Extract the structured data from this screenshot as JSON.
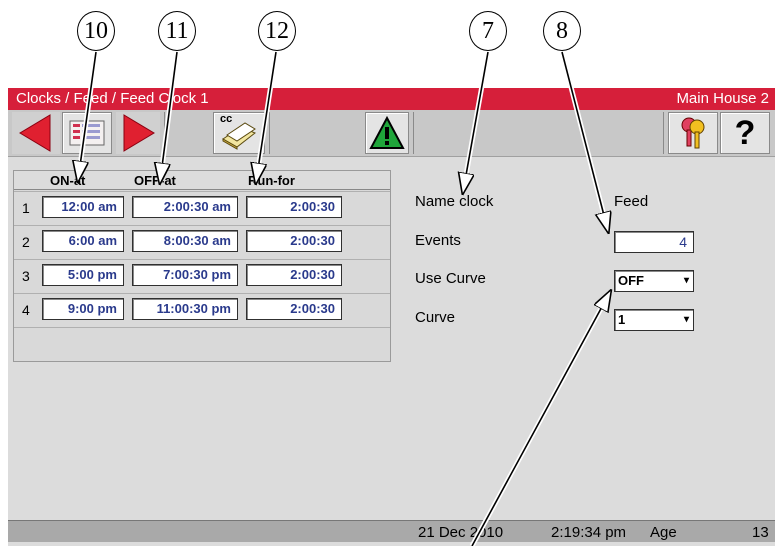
{
  "callouts": [
    "10",
    "11",
    "12",
    "7",
    "8"
  ],
  "titlebar": {
    "breadcrumb": "Clocks / Feed / Feed Clock 1",
    "house": "Main House 2"
  },
  "toolbar": {
    "back_icon": "left-arrow-icon",
    "list_icon": "list-icon",
    "forward_icon": "right-arrow-icon",
    "cc_label": "cc",
    "alarm_icon": "warning-icon",
    "keys_icon": "keys-icon",
    "help_label": "?"
  },
  "table": {
    "headers": {
      "on": "ON-at",
      "off": "OFF-at",
      "run": "Run-for"
    },
    "rows": [
      {
        "num": "1",
        "on": "12:00 am",
        "off": "2:00:30 am",
        "run": "2:00:30"
      },
      {
        "num": "2",
        "on": "6:00 am",
        "off": "8:00:30 am",
        "run": "2:00:30"
      },
      {
        "num": "3",
        "on": "5:00 pm",
        "off": "7:00:30 pm",
        "run": "2:00:30"
      },
      {
        "num": "4",
        "on": "9:00 pm",
        "off": "11:00:30 pm",
        "run": "2:00:30"
      }
    ]
  },
  "settings": {
    "name_label": "Name clock",
    "name_value": "Feed",
    "events_label": "Events",
    "events_value": "4",
    "use_curve_label": "Use Curve",
    "use_curve_value": "OFF",
    "curve_label": "Curve",
    "curve_value": "1"
  },
  "status": {
    "date": "21 Dec 2010",
    "time": "2:19:34 pm",
    "age_label": "Age",
    "age_value": "13"
  },
  "colors": {
    "titlebar": "#d61f3a",
    "field_text": "#2a3a8c",
    "screen_bg": "#dcdcdc"
  }
}
